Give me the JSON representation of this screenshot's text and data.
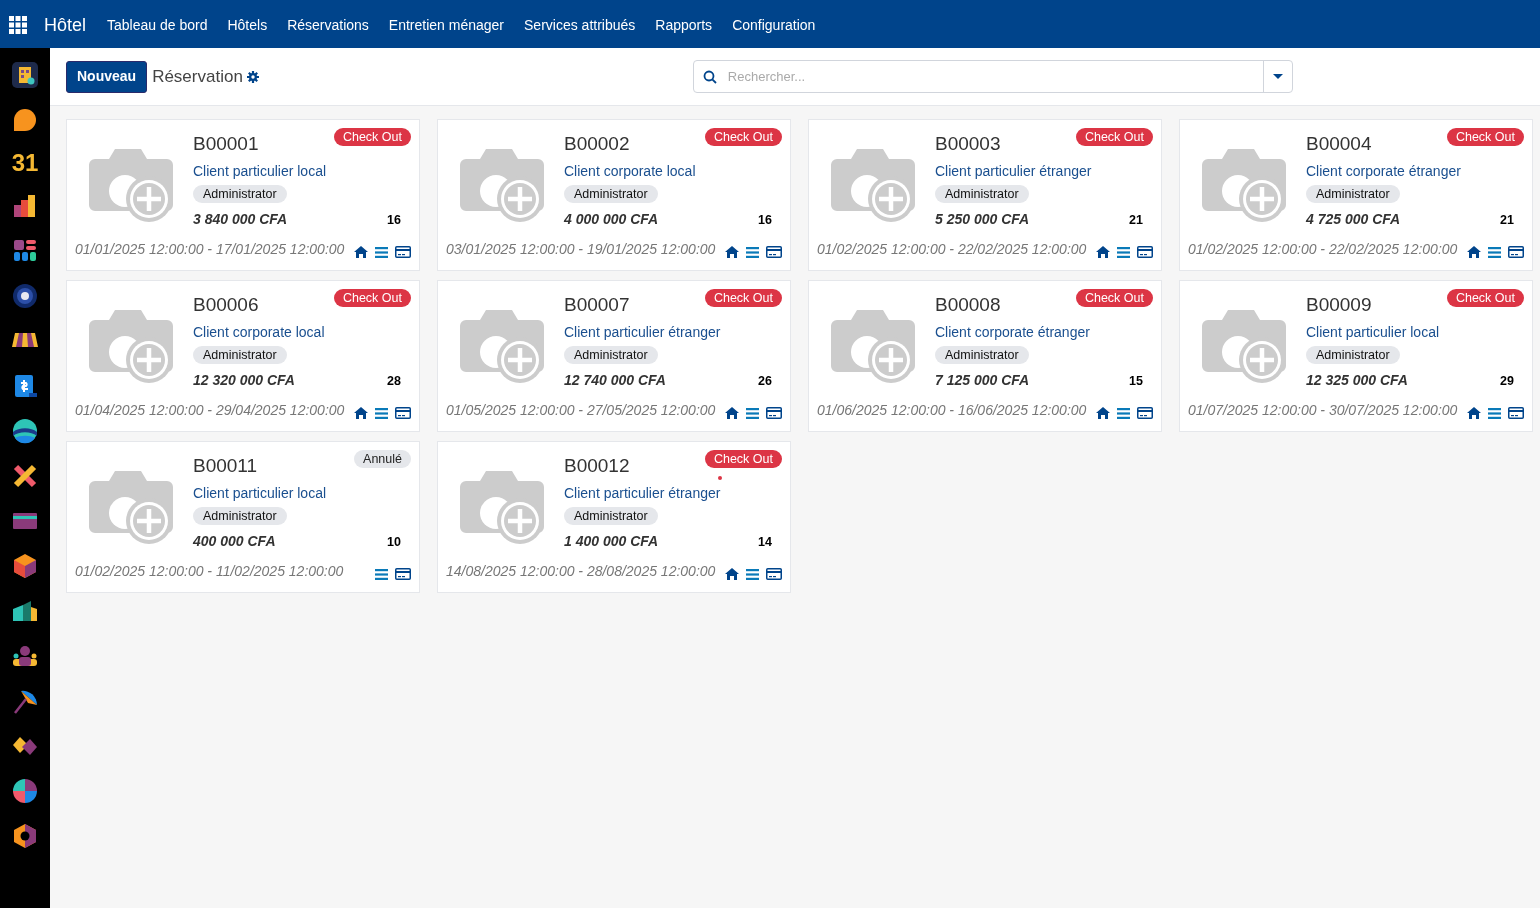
{
  "navbar": {
    "app": "Hôtel",
    "menu": [
      "Tableau de bord",
      "Hôtels",
      "Réservations",
      "Entretien ménager",
      "Services attribués",
      "Rapports",
      "Configuration"
    ]
  },
  "sidebar": [
    {
      "kind": "building"
    },
    {
      "kind": "bubble"
    },
    {
      "kind": "calendar",
      "label": "31"
    },
    {
      "kind": "bars"
    },
    {
      "kind": "grid"
    },
    {
      "kind": "badge"
    },
    {
      "kind": "awning"
    },
    {
      "kind": "dollar"
    },
    {
      "kind": "wave"
    },
    {
      "kind": "cross"
    },
    {
      "kind": "card"
    },
    {
      "kind": "cube"
    },
    {
      "kind": "chart"
    },
    {
      "kind": "people"
    },
    {
      "kind": "umbrella"
    },
    {
      "kind": "diamond"
    },
    {
      "kind": "pie"
    },
    {
      "kind": "hexagon"
    }
  ],
  "control": {
    "new_button": "Nouveau",
    "breadcrumb": "Réservation",
    "search_placeholder": "Rechercher..."
  },
  "cards": [
    {
      "ref": "B00001",
      "status": "Check Out",
      "color": "#dc3545",
      "client": "Client particulier local",
      "user": "Administrator",
      "amount": "3 840 000 CFA",
      "nights": "16",
      "dates": "01/01/2025 12:00:00 - 17/01/2025 12:00:00",
      "home_icon": true,
      "alert": false
    },
    {
      "ref": "B00002",
      "status": "Check Out",
      "color": "#dc3545",
      "client": "Client corporate local",
      "user": "Administrator",
      "amount": "4 000 000 CFA",
      "nights": "16",
      "dates": "03/01/2025 12:00:00 - 19/01/2025 12:00:00",
      "home_icon": true,
      "alert": false
    },
    {
      "ref": "B00003",
      "status": "Check Out",
      "color": "#dc3545",
      "client": "Client particulier étranger",
      "user": "Administrator",
      "amount": "5 250 000 CFA",
      "nights": "21",
      "dates": "01/02/2025 12:00:00 - 22/02/2025 12:00:00",
      "home_icon": true,
      "alert": false
    },
    {
      "ref": "B00004",
      "status": "Check Out",
      "color": "#dc3545",
      "client": "Client corporate étranger",
      "user": "Administrator",
      "amount": "4 725 000 CFA",
      "nights": "21",
      "dates": "01/02/2025 12:00:00 - 22/02/2025 12:00:00",
      "home_icon": true,
      "alert": false
    },
    {
      "ref": "B00006",
      "status": "Check Out",
      "color": "#dc3545",
      "client": "Client corporate local",
      "user": "Administrator",
      "amount": "12 320 000 CFA",
      "nights": "28",
      "dates": "01/04/2025 12:00:00 - 29/04/2025 12:00:00",
      "home_icon": true,
      "alert": false
    },
    {
      "ref": "B00007",
      "status": "Check Out",
      "color": "#dc3545",
      "client": "Client particulier étranger",
      "user": "Administrator",
      "amount": "12 740 000 CFA",
      "nights": "26",
      "dates": "01/05/2025 12:00:00 - 27/05/2025 12:00:00",
      "home_icon": true,
      "alert": false
    },
    {
      "ref": "B00008",
      "status": "Check Out",
      "color": "#dc3545",
      "client": "Client corporate étranger",
      "user": "Administrator",
      "amount": "7 125 000 CFA",
      "nights": "15",
      "dates": "01/06/2025 12:00:00 - 16/06/2025 12:00:00",
      "home_icon": true,
      "alert": false
    },
    {
      "ref": "B00009",
      "status": "Check Out",
      "color": "#dc3545",
      "client": "Client particulier local",
      "user": "Administrator",
      "amount": "12 325 000 CFA",
      "nights": "29",
      "dates": "01/07/2025 12:00:00 - 30/07/2025 12:00:00",
      "home_icon": true,
      "alert": false
    },
    {
      "ref": "B00011",
      "status": "Annulé",
      "color": "#e5e7eb",
      "client": "Client particulier local",
      "user": "Administrator",
      "amount": "400 000 CFA",
      "nights": "10",
      "dates": "01/02/2025 12:00:00 - 11/02/2025 12:00:00",
      "home_icon": false,
      "alert": false
    },
    {
      "ref": "B00012",
      "status": "Check Out",
      "color": "#dc3545",
      "client": "Client particulier étranger",
      "user": "Administrator",
      "amount": "1 400 000 CFA",
      "nights": "14",
      "dates": "14/08/2025 12:00:00 - 28/08/2025 12:00:00",
      "home_icon": true,
      "alert": true
    }
  ]
}
